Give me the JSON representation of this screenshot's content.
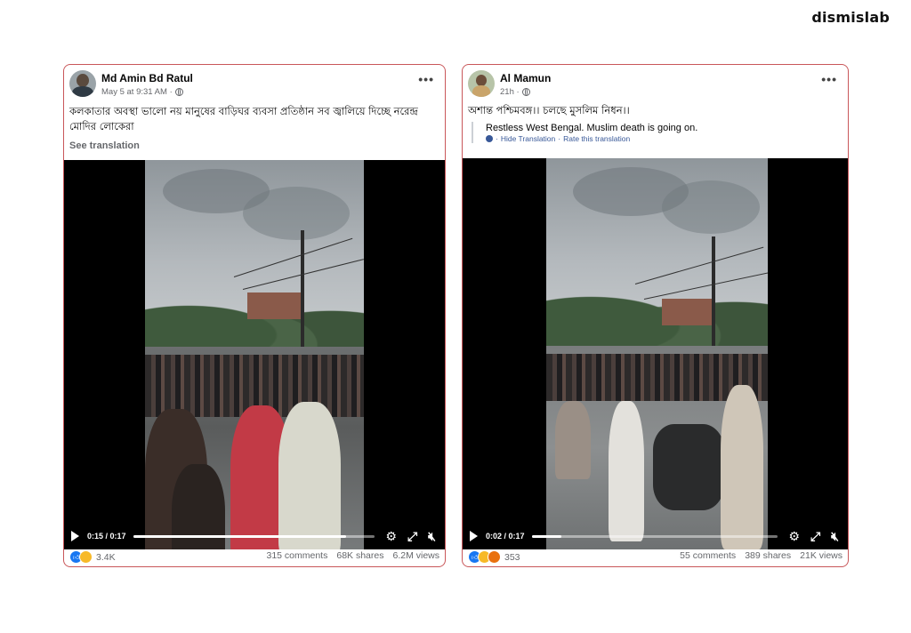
{
  "brand": "dismislab",
  "posts": [
    {
      "author": "Md Amin Bd Ratul",
      "time": "May 5 at 9:31 AM ·",
      "caption": "কলকাতার অবস্থা ভালো নয় মানুষের বাড়িঘর ব্যবসা প্রতিষ্ঠান সব জ্বালিয়ে দিচ্ছে নরেন্দ্র মোদির লোকেরা",
      "see_translation": "See translation",
      "video": {
        "time": "0:15 / 0:17",
        "progress": 0.88
      },
      "reactions": "3.4K",
      "comments": "315 comments",
      "shares": "68K shares",
      "views": "6.2M views"
    },
    {
      "author": "Al Mamun",
      "time": "21h ·",
      "caption": "অশান্ত পশ্চিমবঙ্গ।। চলছে মুসলিম নিধন।।",
      "translation": "Restless West Bengal. Muslim death is going on.",
      "hide_translation": "Hide Translation",
      "rate_translation": "Rate this translation",
      "video": {
        "time": "0:02 / 0:17",
        "progress": 0.12
      },
      "reactions": "353",
      "comments": "55 comments",
      "shares": "389 shares",
      "views": "21K views"
    }
  ],
  "icons": [
    "globe-icon",
    "more-options-icon",
    "play-icon",
    "settings-icon",
    "fullscreen-icon",
    "mute-icon",
    "like-reaction-icon",
    "sad-reaction-icon",
    "angry-reaction-icon"
  ],
  "colors": {
    "card_border": "#c9575a",
    "link": "#385898",
    "muted": "#65676b",
    "like": "#1877f2"
  }
}
